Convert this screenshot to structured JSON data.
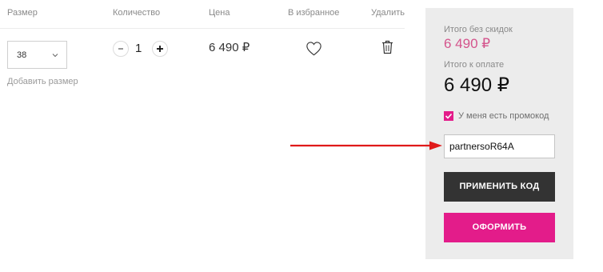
{
  "table": {
    "headers": {
      "size": "Размер",
      "quantity": "Количество",
      "price": "Цена",
      "favorites": "В избранное",
      "delete": "Удалить"
    },
    "row": {
      "size_value": "38",
      "add_size_label": "Добавить размер",
      "quantity": "1",
      "price": "6 490 ₽"
    }
  },
  "summary": {
    "subtotal_label": "Итого без скидок",
    "subtotal_value": "6 490 ₽",
    "total_label": "Итого к оплате",
    "total_value": "6 490 ₽",
    "promo_checkbox_label": "У меня есть промокод",
    "promo_checked": true,
    "promo_value": "partnersoR64A",
    "apply_button": "ПРИМЕНИТЬ КОД",
    "checkout_button": "ОФОРМИТЬ"
  },
  "colors": {
    "accent": "#e31c8a",
    "old_price": "#d4548c",
    "dark_button": "#333333",
    "panel_bg": "#ececec",
    "annotation_arrow": "#e01a1a"
  }
}
